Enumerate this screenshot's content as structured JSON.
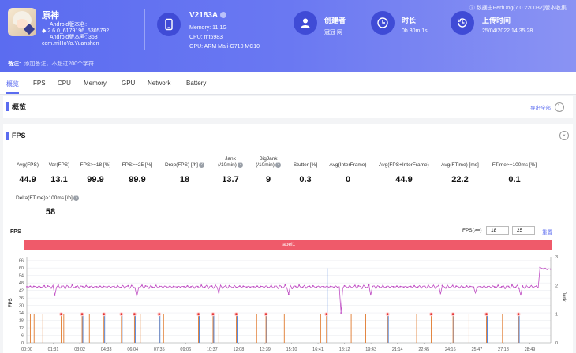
{
  "header": {
    "watermark": "数据由PerfDog(7.0.220032)版本收集",
    "app": {
      "name": "原神",
      "meta": [
        "Android版本名:",
        "2.6.0_6179196_6305792",
        "Android版本号: 363",
        "com.miHoYo.Yuanshen"
      ]
    },
    "device": {
      "name": "V2183A",
      "memory": "Memory: 11.1G",
      "cpu": "CPU: mt6983",
      "gpu": "GPU: ARM Mali-G710 MC10"
    },
    "creator": {
      "label": "创建者",
      "value": "冠冠 网"
    },
    "duration": {
      "label": "时长",
      "value": "0h 30m 1s"
    },
    "upload": {
      "label": "上传时间",
      "value": "25/04/2022 14:35:28"
    },
    "note": {
      "label": "备注:",
      "placeholder": "添加备注，不超过200个字符"
    },
    "colors": {
      "header": "#5b6cf0",
      "icon_circle": "#3f4bd6"
    }
  },
  "tabs": [
    "概览",
    "FPS",
    "CPU",
    "Memory",
    "GPU",
    "Network",
    "Battery"
  ],
  "overview": {
    "title": "概览",
    "export": "导出全部"
  },
  "fps_panel": {
    "title": "FPS",
    "metrics": [
      {
        "label": "Avg(FPS)",
        "value": "44.9"
      },
      {
        "label": "Var(FPS)",
        "value": "13.1"
      },
      {
        "label": "FPS>=18 [%]",
        "value": "99.9"
      },
      {
        "label": "FPS>=25 [%]",
        "value": "99.9"
      },
      {
        "label": "Drop(FPS) [/h]",
        "value": "18"
      },
      {
        "label": "Jank\n(/10min)",
        "value": "13.7"
      },
      {
        "label": "BigJank\n(/10min)",
        "value": "9"
      },
      {
        "label": "Stutter [%]",
        "value": "0.3"
      },
      {
        "label": "Avg(InterFrame)",
        "value": "0"
      },
      {
        "label": "Avg(FPS+InterFrame)",
        "value": "44.9"
      },
      {
        "label": "Avg(FTime) [ms]",
        "value": "22.2"
      },
      {
        "label": "FTime>=100ms [%]",
        "value": "0.1"
      },
      {
        "label": "Delta(FTime)>100ms [/h]",
        "value": "58"
      }
    ],
    "chart_title": "FPS",
    "fps_threshold_label": "FPS(>=)",
    "threshold_1": "18",
    "threshold_2": "25",
    "reset_label": "重置",
    "label_bar": "label1"
  },
  "chart_data": {
    "type": "line",
    "title": "FPS",
    "ylabel": "FPS",
    "y2label": "Jank",
    "ylim": [
      0,
      69
    ],
    "y_ticks": [
      0,
      6,
      12,
      18,
      24,
      30,
      36,
      42,
      48,
      54,
      60,
      66
    ],
    "y2lim": [
      0,
      3
    ],
    "y2_ticks": [
      0,
      1,
      2,
      3
    ],
    "x_ticks": [
      "00:00",
      "01:31",
      "03:02",
      "04:33",
      "06:04",
      "07:35",
      "09:06",
      "10:37",
      "12:08",
      "13:39",
      "15:10",
      "16:41",
      "18:12",
      "19:43",
      "21:14",
      "22:45",
      "24:16",
      "25:47",
      "27:18",
      "28:49"
    ],
    "x_range_seconds": [
      0,
      1801
    ],
    "series": [
      {
        "name": "FPS",
        "color": "#c04fc4",
        "profile": [
          [
            0,
            45
          ],
          [
            1760,
            45
          ],
          [
            1762,
            60
          ],
          [
            1801,
            59
          ]
        ],
        "dips": [
          [
            98,
            38
          ],
          [
            380,
            37
          ],
          [
            660,
            40
          ],
          [
            900,
            39
          ],
          [
            1080,
            24
          ],
          [
            1180,
            38
          ],
          [
            1420,
            39
          ],
          [
            1540,
            40
          ],
          [
            1700,
            38
          ]
        ]
      },
      {
        "name": "Jank",
        "color": "#e07a2e"
      },
      {
        "name": "BigJank",
        "color": "#4a7fd8"
      }
    ],
    "jank_times": [
      12,
      25,
      55,
      118,
      127,
      190,
      215,
      265,
      325,
      370,
      390,
      455,
      470,
      590,
      640,
      660,
      720,
      790,
      822,
      885,
      1010,
      1030,
      1070,
      1115,
      1165,
      1240,
      1340,
      1390,
      1465,
      1520,
      1580,
      1635,
      1690,
      1740
    ],
    "bigjank_times": [
      118,
      190,
      265,
      325,
      370,
      455,
      590,
      640,
      720,
      822,
      1030,
      1240,
      1390,
      1465,
      1580,
      1690
    ],
    "bigjank_peak": {
      "time": 1030,
      "y2": 2.6
    }
  }
}
